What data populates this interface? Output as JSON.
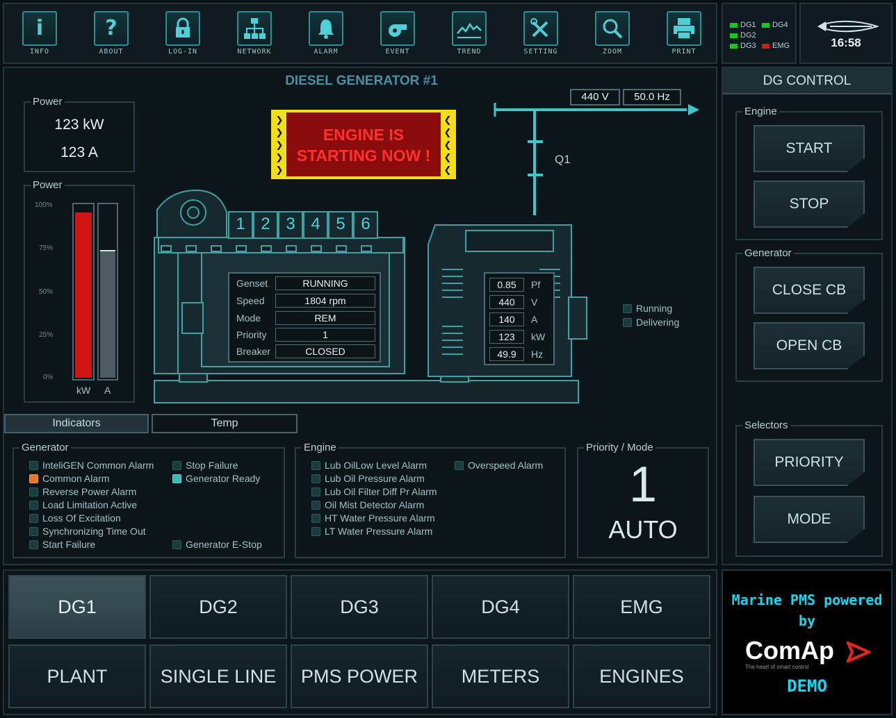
{
  "toolbar": {
    "buttons": [
      {
        "label": "INFO",
        "glyph": "i"
      },
      {
        "label": "ABOUT",
        "glyph": "?"
      },
      {
        "label": "LOG-IN",
        "glyph": "lock"
      },
      {
        "label": "NETWORK",
        "glyph": "network"
      },
      {
        "label": "ALARM",
        "glyph": "bell"
      },
      {
        "label": "EVENT",
        "glyph": "whistle"
      },
      {
        "label": "TREND",
        "glyph": "trend"
      },
      {
        "label": "SETTING",
        "glyph": "tools"
      },
      {
        "label": "ZOOM",
        "glyph": "zoom"
      },
      {
        "label": "PRINT",
        "glyph": "printer"
      }
    ]
  },
  "status": {
    "items": [
      {
        "label": "DG1",
        "color": "#1ec41e"
      },
      {
        "label": "DG4",
        "color": "#1ec41e"
      },
      {
        "label": "DG2",
        "color": "#1ec41e"
      },
      {
        "label": "DG3",
        "color": "#1ec41e"
      },
      {
        "label": "EMG",
        "color": "#d21a1a"
      }
    ],
    "time": "16:58"
  },
  "main": {
    "title": "DIESEL GENERATOR #1",
    "power_box": {
      "label": "Power",
      "kw": "123 kW",
      "amps": "123 A"
    },
    "power_bars": {
      "label": "Power",
      "ticks": [
        "100%",
        "75%",
        "50%",
        "25%",
        "0%"
      ],
      "kw_label": "kW",
      "a_label": "A",
      "kw_fraction": 0.96,
      "a_fraction": 0.74
    },
    "banner": {
      "line1": "ENGINE IS",
      "line2": "STARTING NOW !"
    },
    "bus": {
      "voltage": "440 V",
      "frequency": "50.0 Hz",
      "breaker_label": "Q1"
    },
    "cylinders": [
      "1",
      "2",
      "3",
      "4",
      "5",
      "6"
    ],
    "genset_info": [
      {
        "label": "Genset",
        "value": "RUNNING"
      },
      {
        "label": "Speed",
        "value": "1804 rpm"
      },
      {
        "label": "Mode",
        "value": "REM"
      },
      {
        "label": "Priority",
        "value": "1"
      },
      {
        "label": "Breaker",
        "value": "CLOSED"
      }
    ],
    "electrical": [
      {
        "value": "0.85",
        "unit": "Pf"
      },
      {
        "value": "440",
        "unit": "V"
      },
      {
        "value": "140",
        "unit": "A"
      },
      {
        "value": "123",
        "unit": "kW"
      },
      {
        "value": "49.9",
        "unit": "Hz"
      }
    ],
    "state_legend": [
      "Running",
      "Delivering"
    ],
    "tabs": [
      "Indicators",
      "Temp"
    ]
  },
  "indicators": {
    "generator": {
      "label": "Generator",
      "col1": [
        {
          "text": "InteliGEN Common Alarm",
          "state": "off"
        },
        {
          "text": "Common Alarm",
          "state": "orange"
        },
        {
          "text": "Reverse Power Alarm",
          "state": "off"
        },
        {
          "text": "Load Limitation Active",
          "state": "off"
        },
        {
          "text": "Loss Of Excitation",
          "state": "off"
        },
        {
          "text": "Synchronizing Time Out",
          "state": "off"
        },
        {
          "text": "Start Failure",
          "state": "off"
        }
      ],
      "col2": [
        {
          "text": "Stop Failure",
          "state": "off"
        },
        {
          "text": "Generator Ready",
          "state": "teal"
        }
      ],
      "estop": {
        "text": "Generator E-Stop",
        "state": "off"
      }
    },
    "engine": {
      "label": "Engine",
      "col1": [
        {
          "text": "Lub OilLow Level Alarm",
          "state": "off"
        },
        {
          "text": "Lub Oil Pressure Alarm",
          "state": "off"
        },
        {
          "text": "Lub Oil Filter Diff Pr Alarm",
          "state": "off"
        },
        {
          "text": "Oil Mist Detector Alarm",
          "state": "off"
        },
        {
          "text": "HT Water Pressure Alarm",
          "state": "off"
        },
        {
          "text": "LT Water Pressure Alarm",
          "state": "off"
        }
      ],
      "col2": [
        {
          "text": "Overspeed Alarm",
          "state": "off"
        }
      ]
    },
    "priority_mode": {
      "label": "Priority / Mode",
      "priority": "1",
      "mode": "AUTO"
    }
  },
  "control": {
    "title": "DG CONTROL",
    "engine_label": "Engine",
    "start": "START",
    "stop": "STOP",
    "generator_label": "Generator",
    "close_cb": "CLOSE CB",
    "open_cb": "OPEN CB",
    "selectors_label": "Selectors",
    "priority": "PRIORITY",
    "mode": "MODE"
  },
  "nav": {
    "row1": [
      "DG1",
      "DG2",
      "DG3",
      "DG4",
      "EMG"
    ],
    "row2": [
      "PLANT",
      "SINGLE LINE",
      "PMS POWER",
      "METERS",
      "ENGINES"
    ],
    "active": "DG1"
  },
  "brand": {
    "line1": "Marine PMS powered",
    "line2": "by",
    "logo": "ComAp",
    "tagline": "The heart of smart control",
    "demo": "DEMO"
  },
  "colors": {
    "accent": "#3fd0d8",
    "alarm_red": "#d11414",
    "banner_yellow": "#f2df1a",
    "brand_cyan": "#14d8f0"
  }
}
